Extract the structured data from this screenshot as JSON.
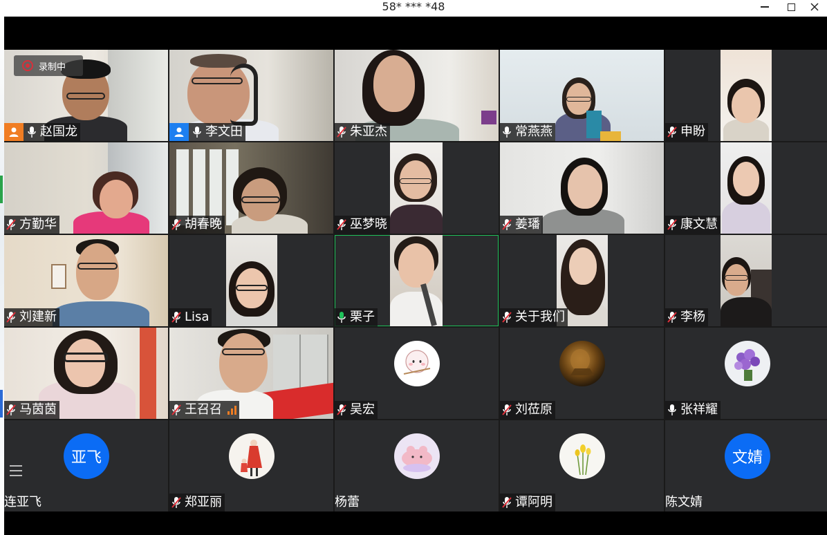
{
  "window": {
    "title": "58* *** *48"
  },
  "recording": {
    "label": "录制中"
  },
  "participants": [
    {
      "name": "赵国龙",
      "mic": "on",
      "host": "orange"
    },
    {
      "name": "李文田",
      "mic": "on",
      "host": "blue"
    },
    {
      "name": "朱亚杰",
      "mic": "muted"
    },
    {
      "name": "常燕燕",
      "mic": "on"
    },
    {
      "name": "申盼",
      "mic": "muted"
    },
    {
      "name": "方勤华",
      "mic": "muted"
    },
    {
      "name": "胡春晚",
      "mic": "muted"
    },
    {
      "name": "巫梦晓",
      "mic": "muted"
    },
    {
      "name": "姜璠",
      "mic": "muted"
    },
    {
      "name": "康文慧",
      "mic": "muted"
    },
    {
      "name": "刘建新",
      "mic": "muted"
    },
    {
      "name": "Lisa",
      "mic": "muted"
    },
    {
      "name": "栗子",
      "mic": "speaking",
      "active": true
    },
    {
      "name": "关于我们",
      "mic": "muted"
    },
    {
      "name": "李杨",
      "mic": "muted"
    },
    {
      "name": "马茵茵",
      "mic": "muted"
    },
    {
      "name": "王召召",
      "mic": "muted",
      "signal": "signal-bars-icon"
    },
    {
      "name": "吴宏",
      "mic": "muted",
      "avatar": "cartoon-bun-avatar"
    },
    {
      "name": "刘莅原",
      "mic": "muted",
      "avatar": "lion-photo-avatar"
    },
    {
      "name": "张祥耀",
      "mic": "on",
      "avatar": "purple-flowers-avatar"
    },
    {
      "name": "连亚飞",
      "mic": "none",
      "avatar_text": "亚飞"
    },
    {
      "name": "郑亚丽",
      "mic": "muted",
      "avatar": "illustration-girl-avatar"
    },
    {
      "name": "杨蕾",
      "mic": "none",
      "avatar": "pink-cloud-avatar"
    },
    {
      "name": "谭阿明",
      "mic": "muted",
      "avatar": "yellow-tulips-avatar"
    },
    {
      "name": "陈文婧",
      "mic": "none",
      "avatar_text": "文婧"
    }
  ],
  "colors": {
    "host_orange": "#f07d23",
    "host_blue": "#1d7ff0",
    "muted_red": "#e0303a",
    "speaking_green": "#1fc15a",
    "avatar_blue": "#0b6cf5"
  }
}
